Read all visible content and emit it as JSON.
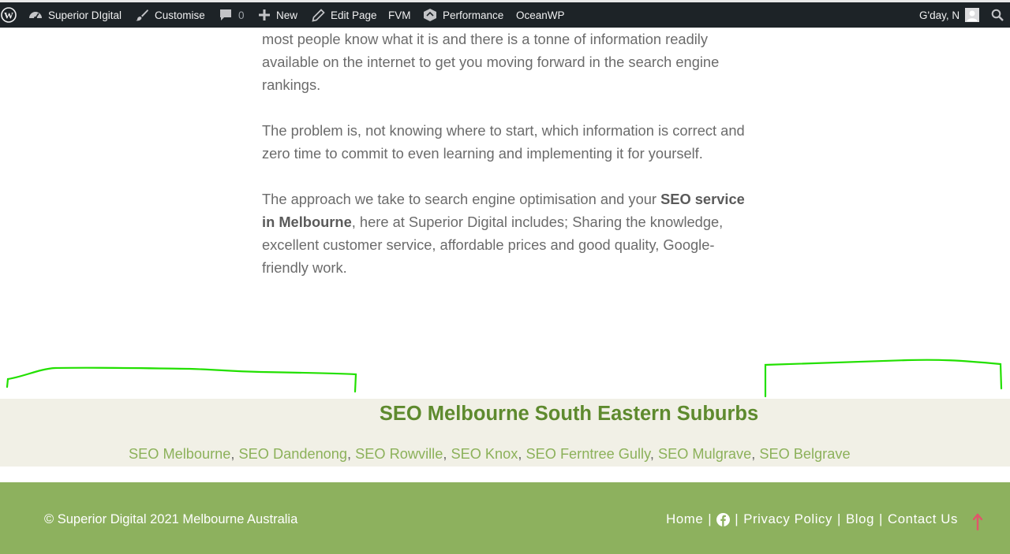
{
  "admin_bar": {
    "site_name": "Superior DIgital",
    "customise": "Customise",
    "comments_count": "0",
    "new": "New",
    "edit_page": "Edit Page",
    "fvm": "FVM",
    "performance": "Performance",
    "oceanwp": "OceanWP",
    "greeting": "G'day, N"
  },
  "article": {
    "p1": "most people know what it is and there is a tonne of information readily available on the internet to get you moving forward in the search engine rankings.",
    "p2": "The problem is, not knowing where to start, which information is correct and zero time to commit to even learning and implementing it for yourself.",
    "p3_before": "The approach we take to search engine optimisation and your ",
    "p3_bold": "SEO service in Melbourne",
    "p3_after": ", here at Superior Digital includes; Sharing the knowledge, excellent customer service, affordable prices and good quality, Google-friendly work."
  },
  "suburbs": {
    "title": "SEO Melbourne South Eastern Suburbs",
    "links": [
      "SEO Melbourne",
      "SEO Dandenong",
      "SEO Rowville",
      "SEO Knox",
      "SEO Ferntree Gully",
      "SEO Mulgrave",
      "SEO Belgrave"
    ],
    "separator": ", "
  },
  "footer": {
    "copyright": "© Superior Digital 2021 Melbourne Australia",
    "nav": {
      "home": "Home",
      "privacy": "Privacy Policy",
      "blog": "Blog",
      "contact": "Contact Us",
      "separator": "|"
    }
  },
  "colors": {
    "admin_bar_bg": "#1d2327",
    "heading_green": "#5e8a2e",
    "link_green": "#8cb15a",
    "footer_bg": "#8db15e",
    "suburbs_bg": "#f1f0e6",
    "annotation": "#22e000",
    "scroll_arrow": "#e0566a"
  },
  "icons": [
    "wordpress-icon",
    "dashboard-icon",
    "brush-icon",
    "comment-icon",
    "plus-icon",
    "pencil-icon",
    "performance-icon",
    "avatar",
    "search-icon",
    "facebook-icon",
    "arrow-up-icon"
  ]
}
